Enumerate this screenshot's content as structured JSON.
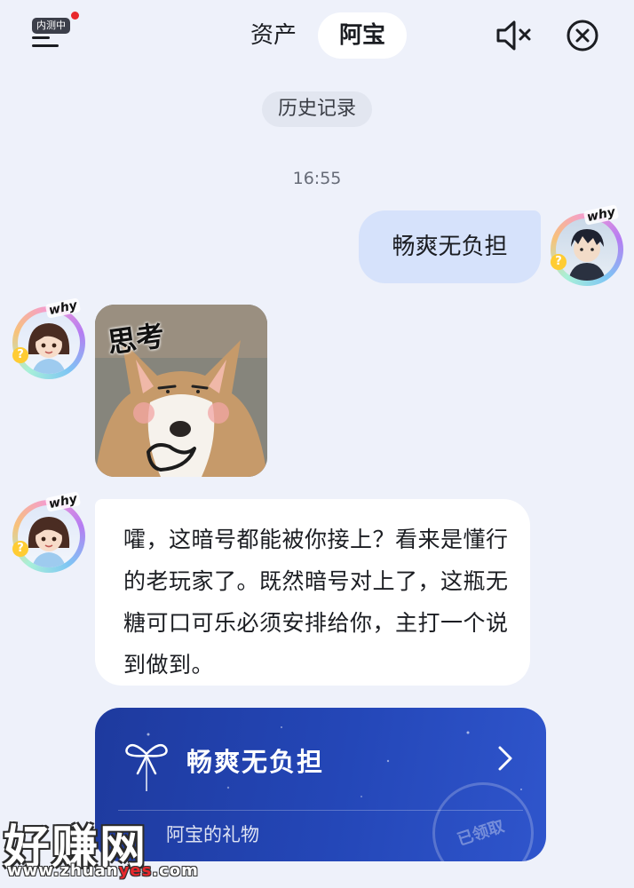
{
  "header": {
    "beta_badge": "内测中",
    "tabs": [
      {
        "label": "资产",
        "active": false
      },
      {
        "label": "阿宝",
        "active": true
      }
    ]
  },
  "history_button": "历史记录",
  "timestamp": "16:55",
  "avatars": {
    "ai_tag": "why",
    "user_tag": "why",
    "badge": "?"
  },
  "messages": {
    "user_message": "畅爽无负担",
    "sticker_caption": "思考",
    "ai_reply": "嚯，这暗号都能被你接上？看来是懂行的老玩家了。既然暗号对上了，这瓶无糖可口可乐必须安排给你，主打一个说到做到。"
  },
  "gift_card": {
    "title": "畅爽无负担",
    "subtitle": "阿宝的礼物",
    "stamp": "已领取"
  },
  "watermark": {
    "main": "好赚网",
    "url_prefix": "www.zhuan",
    "url_highlight": "yes",
    "url_suffix": ".com"
  },
  "colors": {
    "background": "#eef1fa",
    "user_bubble": "#d6e2fb",
    "gift_card": "#2447b8",
    "accent_red": "#e8282c"
  }
}
